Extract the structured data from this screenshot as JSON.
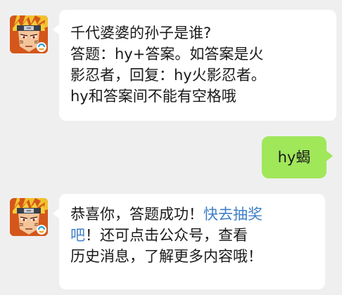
{
  "messages": [
    {
      "sender": "official_account",
      "lines": [
        "千代婆婆的孙子是谁?",
        "答题：hy+答案。如答案是火",
        "影忍者，回复：hy火影忍者。",
        "hy和答案间不能有空格哦"
      ]
    },
    {
      "sender": "me",
      "text": "hy蝎"
    },
    {
      "sender": "official_account",
      "line1_before": "恭喜你，答题成功！",
      "line1_link": "快去抽奖",
      "line2_link": "吧",
      "line2_after": "！还可点击公众号，查看",
      "line3": "历史消息，了解更多内容哦！"
    }
  ],
  "colors": {
    "background": "#efefef",
    "bubble_incoming": "#ffffff",
    "bubble_outgoing": "#a0e75a",
    "link": "#3f7fc6"
  },
  "icons": {
    "avatar": "naruto-avatar-icon",
    "badge": "tencent-games-badge-icon"
  }
}
